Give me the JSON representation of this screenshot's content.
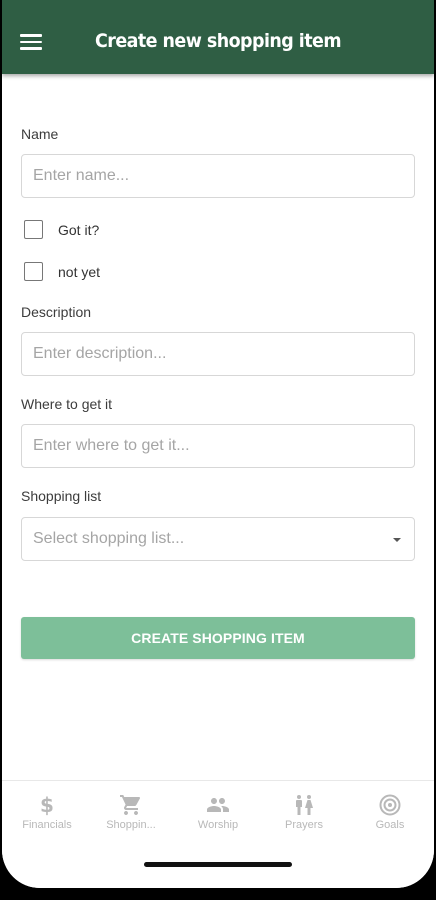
{
  "app_bar": {
    "title": "Create new shopping item"
  },
  "form": {
    "name": {
      "label": "Name",
      "placeholder": "Enter name..."
    },
    "checkboxes": [
      {
        "label": "Got it?",
        "checked": false
      },
      {
        "label": "not yet",
        "checked": false
      }
    ],
    "description": {
      "label": "Description",
      "placeholder": "Enter description..."
    },
    "where": {
      "label": "Where to get it",
      "placeholder": "Enter where to get it..."
    },
    "shopping_list": {
      "label": "Shopping list",
      "placeholder": "Select shopping list..."
    },
    "submit_label": "CREATE SHOPPING ITEM"
  },
  "bottom_nav": [
    {
      "label": "Financials",
      "icon": "dollar-icon"
    },
    {
      "label": "Shoppin...",
      "icon": "cart-icon"
    },
    {
      "label": "Worship",
      "icon": "people-icon"
    },
    {
      "label": "Prayers",
      "icon": "family-icon"
    },
    {
      "label": "Goals",
      "icon": "target-icon"
    }
  ],
  "colors": {
    "app_bar": "#2f5e44",
    "button": "#7dbf99",
    "nav_inactive": "#b8b8b8"
  }
}
